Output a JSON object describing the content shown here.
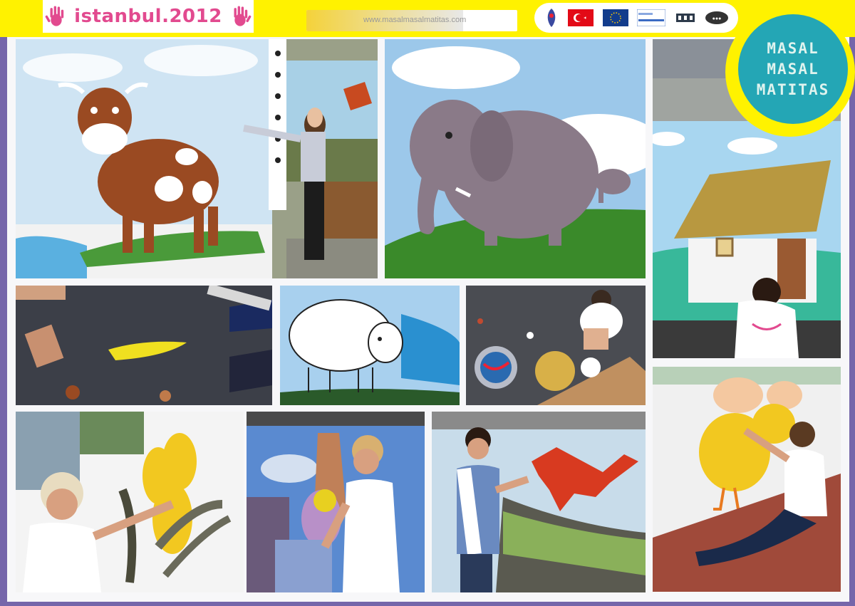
{
  "header": {
    "logo_text": "istanbul.2012",
    "website_text": "www.masalmasalmatitas.com",
    "partner_logos": [
      "ua-logo",
      "turkey-flag-logo",
      "eu-flag-logo",
      "gencik-programi-logo",
      "ministry-logo",
      "partner-logo"
    ]
  },
  "badge": {
    "lines": [
      "MASAL",
      "MASAL",
      "MATITAS"
    ]
  },
  "colors": {
    "top_bar": "#fff200",
    "frame": "#7566aa",
    "badge": "#24a6b5",
    "logo_accent": "#e24a8f"
  },
  "photos": [
    {
      "id": "cow-mural",
      "subject": "girl beside cow mural"
    },
    {
      "id": "elephant-mural",
      "subject": "elephant mural"
    },
    {
      "id": "house-mural",
      "subject": "person painting house mural"
    },
    {
      "id": "ground-paint",
      "subject": "yellow paint on asphalt"
    },
    {
      "id": "sheep-mural",
      "subject": "sheep mural"
    },
    {
      "id": "paint-supplies",
      "subject": "girl with paint supplies"
    },
    {
      "id": "sunflower-mural",
      "subject": "woman painting sunflowers"
    },
    {
      "id": "children-mural",
      "subject": "girl in front of children mural"
    },
    {
      "id": "red-dog-mural",
      "subject": "boy painting red dog"
    },
    {
      "id": "chick-mural",
      "subject": "girl painting chick"
    }
  ]
}
